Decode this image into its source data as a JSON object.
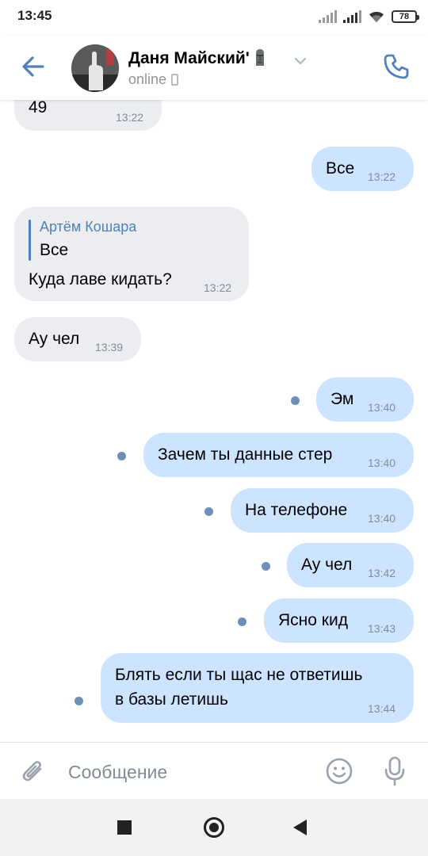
{
  "status_bar": {
    "time": "13:45",
    "battery": "78"
  },
  "header": {
    "name": "Даня Майский'",
    "status": "online",
    "name_emoji_icon": "moai-icon",
    "back_icon": "arrow-left-icon",
    "call_icon": "phone-icon"
  },
  "messages": [
    {
      "dir": "in",
      "text": "49",
      "time": "13:22"
    },
    {
      "dir": "out",
      "text": "Все",
      "time": "13:22"
    },
    {
      "dir": "in",
      "reply_author": "Артём Кошара",
      "reply_text": "Все",
      "text": "Куда лаве кидать?",
      "time": "13:22"
    },
    {
      "dir": "in",
      "text": "Ау чел",
      "time": "13:39"
    },
    {
      "dir": "out",
      "text": "Эм",
      "time": "13:40",
      "unread": true
    },
    {
      "dir": "out",
      "text": "Зачем ты данные стер",
      "time": "13:40",
      "unread": true
    },
    {
      "dir": "out",
      "text": "На телефоне",
      "time": "13:40",
      "unread": true
    },
    {
      "dir": "out",
      "text": "Ау чел",
      "time": "13:42",
      "unread": true
    },
    {
      "dir": "out",
      "text": "Ясно кид",
      "time": "13:43",
      "unread": true
    },
    {
      "dir": "out",
      "text_line1": "Блять если ты щас не ответишь",
      "text_line2": "в базы летишь",
      "time": "13:44",
      "unread": true
    }
  ],
  "composer": {
    "placeholder": "Сообщение",
    "attach_icon": "paperclip-icon",
    "emoji_icon": "smile-icon",
    "mic_icon": "microphone-icon"
  },
  "colors": {
    "accent": "#5181b8",
    "incoming_bubble": "#ebedf0",
    "outgoing_bubble": "#cce4ff",
    "unread_dot": "#6e8fba",
    "time_text": "#818c99"
  }
}
